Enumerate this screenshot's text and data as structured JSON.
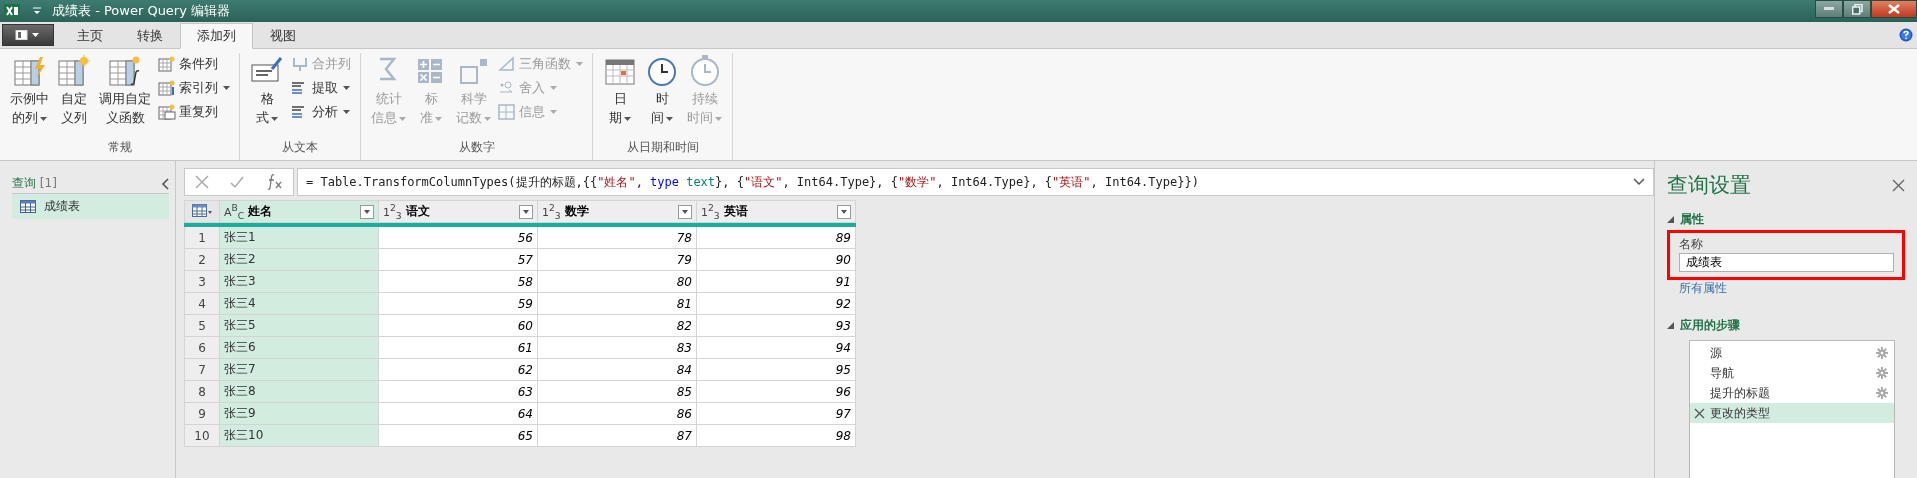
{
  "window": {
    "title": "成绩表 - Power Query 编辑器"
  },
  "tabs": [
    {
      "label": "主页",
      "selected": false
    },
    {
      "label": "转换",
      "selected": false
    },
    {
      "label": "添加列",
      "selected": true
    },
    {
      "label": "视图",
      "selected": false
    }
  ],
  "ribbon": {
    "groups": [
      {
        "label": "常规",
        "items": [
          {
            "kind": "large",
            "lines": [
              "示例中",
              "的列"
            ],
            "dropdown": true,
            "disabled": false
          },
          {
            "kind": "large",
            "lines": [
              "自定",
              "义列"
            ],
            "dropdown": false,
            "disabled": false
          },
          {
            "kind": "large",
            "lines": [
              "调用自定",
              "义函数"
            ],
            "dropdown": false,
            "disabled": false
          },
          {
            "kind": "small",
            "lines": [
              "条件列"
            ],
            "dropdown": false,
            "disabled": false
          },
          {
            "kind": "small",
            "lines": [
              "索引列"
            ],
            "dropdown": true,
            "disabled": false
          },
          {
            "kind": "small",
            "lines": [
              "重复列"
            ],
            "dropdown": false,
            "disabled": false
          }
        ]
      },
      {
        "label": "从文本",
        "items": [
          {
            "kind": "large",
            "lines": [
              "格",
              "式"
            ],
            "dropdown": true,
            "disabled": false
          },
          {
            "kind": "small",
            "lines": [
              "合并列"
            ],
            "dropdown": false,
            "disabled": true
          },
          {
            "kind": "small",
            "lines": [
              "提取"
            ],
            "dropdown": true,
            "disabled": false
          },
          {
            "kind": "small",
            "lines": [
              "分析"
            ],
            "dropdown": true,
            "disabled": false
          }
        ]
      },
      {
        "label": "从数字",
        "items": [
          {
            "kind": "large",
            "lines": [
              "统计",
              "信息"
            ],
            "dropdown": true,
            "disabled": true
          },
          {
            "kind": "large",
            "lines": [
              "标",
              "准"
            ],
            "dropdown": true,
            "disabled": true
          },
          {
            "kind": "large",
            "lines": [
              "科学",
              "记数"
            ],
            "dropdown": true,
            "disabled": true
          },
          {
            "kind": "small",
            "lines": [
              "三角函数"
            ],
            "dropdown": true,
            "disabled": true
          },
          {
            "kind": "small",
            "lines": [
              "舍入"
            ],
            "dropdown": true,
            "disabled": true
          },
          {
            "kind": "small",
            "lines": [
              "信息"
            ],
            "dropdown": true,
            "disabled": true
          }
        ]
      },
      {
        "label": "从日期和时间",
        "items": [
          {
            "kind": "large",
            "lines": [
              "日",
              "期"
            ],
            "dropdown": true,
            "disabled": false
          },
          {
            "kind": "large",
            "lines": [
              "时",
              "间"
            ],
            "dropdown": true,
            "disabled": false
          },
          {
            "kind": "large",
            "lines": [
              "持续",
              "时间"
            ],
            "dropdown": true,
            "disabled": true
          }
        ]
      }
    ]
  },
  "queries": {
    "title": "查询",
    "count": "[1]",
    "items": [
      {
        "label": "成绩表",
        "selected": true
      }
    ]
  },
  "formula": {
    "segments": [
      {
        "kind": "plain",
        "text": "= Table.TransformColumnTypes(提升的标题,{{"
      },
      {
        "kind": "string",
        "text": "\"姓名\""
      },
      {
        "kind": "plain",
        "text": ","
      },
      {
        "kind": "keyword",
        "text": "type"
      },
      {
        "kind": "type",
        "text": "text"
      },
      {
        "kind": "plain",
        "text": "}, {"
      },
      {
        "kind": "string",
        "text": "\"语文\""
      },
      {
        "kind": "plain",
        "text": ", Int64.Type}, {"
      },
      {
        "kind": "string",
        "text": "\"数学\""
      },
      {
        "kind": "plain",
        "text": ", Int64.Type}, {"
      },
      {
        "kind": "string",
        "text": "\"英语\""
      },
      {
        "kind": "plain",
        "text": ", Int64.Type}})"
      }
    ]
  },
  "table": {
    "columns": [
      {
        "name": "姓名",
        "type_label": "A$^{B}$$_{C}$",
        "numeric": false,
        "selected": true
      },
      {
        "name": "语文",
        "type_label": "1$^{2}$$_{3}$",
        "numeric": true,
        "selected": false
      },
      {
        "name": "数学",
        "type_label": "1$^{2}$$_{3}$",
        "numeric": true,
        "selected": false
      },
      {
        "name": "英语",
        "type_label": "1$^{2}$$_{3}$",
        "numeric": true,
        "selected": false
      }
    ],
    "rows": [
      {
        "number": "1",
        "cells": [
          "张三1",
          "56",
          "78",
          "89"
        ]
      },
      {
        "number": "2",
        "cells": [
          "张三2",
          "57",
          "79",
          "90"
        ]
      },
      {
        "number": "3",
        "cells": [
          "张三3",
          "58",
          "80",
          "91"
        ]
      },
      {
        "number": "4",
        "cells": [
          "张三4",
          "59",
          "81",
          "92"
        ]
      },
      {
        "number": "5",
        "cells": [
          "张三5",
          "60",
          "82",
          "93"
        ]
      },
      {
        "number": "6",
        "cells": [
          "张三6",
          "61",
          "83",
          "94"
        ]
      },
      {
        "number": "7",
        "cells": [
          "张三7",
          "62",
          "84",
          "95"
        ]
      },
      {
        "number": "8",
        "cells": [
          "张三8",
          "63",
          "85",
          "96"
        ]
      },
      {
        "number": "9",
        "cells": [
          "张三9",
          "64",
          "86",
          "97"
        ]
      },
      {
        "number": "10",
        "cells": [
          "张三10",
          "65",
          "87",
          "98"
        ]
      }
    ]
  },
  "settings": {
    "title": "查询设置",
    "properties": {
      "heading": "属性",
      "name_label": "名称",
      "name_value": "成绩表",
      "highlighted": true,
      "link": "所有属性"
    },
    "steps_heading": "应用的步骤",
    "steps": [
      {
        "label": "源",
        "has_settings": true,
        "selected": false
      },
      {
        "label": "导航",
        "has_settings": true,
        "selected": false
      },
      {
        "label": "提升的标题",
        "has_settings": true,
        "selected": false
      },
      {
        "label": "更改的类型",
        "has_settings": false,
        "selected": true
      }
    ]
  }
}
